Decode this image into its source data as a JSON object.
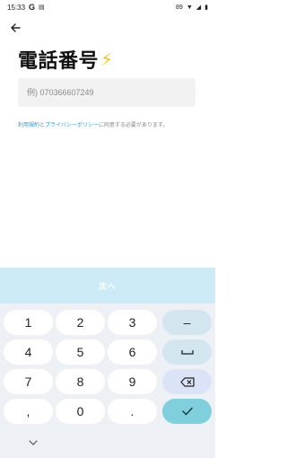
{
  "status_bar": {
    "time": "15:33",
    "g_label": "G",
    "battery_label": "89"
  },
  "header": {
    "title": "電話番号",
    "emoji": "⚡"
  },
  "phone_input": {
    "placeholder": "例) 070366607249",
    "value": ""
  },
  "terms": {
    "link1": "利用規約",
    "conj": "と",
    "link2": "プライバシーポリシー",
    "rest": "に同意する必要があります。"
  },
  "next_button": {
    "label": "次へ"
  },
  "keypad": {
    "keys": [
      "1",
      "2",
      "3",
      "4",
      "5",
      "6",
      "7",
      "8",
      "9",
      ",",
      "0",
      "."
    ],
    "minus": "–"
  },
  "colors": {
    "accent": "#2b9ad6",
    "next_bg": "#cdebf6",
    "done_key": "#7fd0dc"
  }
}
